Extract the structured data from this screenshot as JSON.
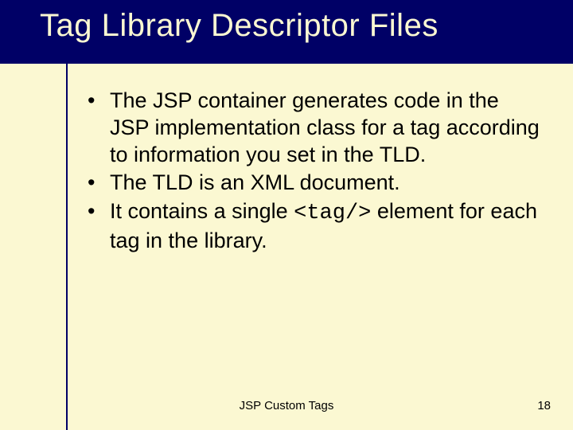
{
  "title": "Tag Library Descriptor Files",
  "bullets": {
    "b1": "The JSP container generates code in the JSP implementation class for a tag according to information you set in the TLD.",
    "b2": "The TLD is an XML document.",
    "b3a": "It contains a single ",
    "b3code": "<tag/>",
    "b3b": " element for each tag in the library."
  },
  "footer": {
    "label": "JSP Custom Tags",
    "page": "18"
  }
}
